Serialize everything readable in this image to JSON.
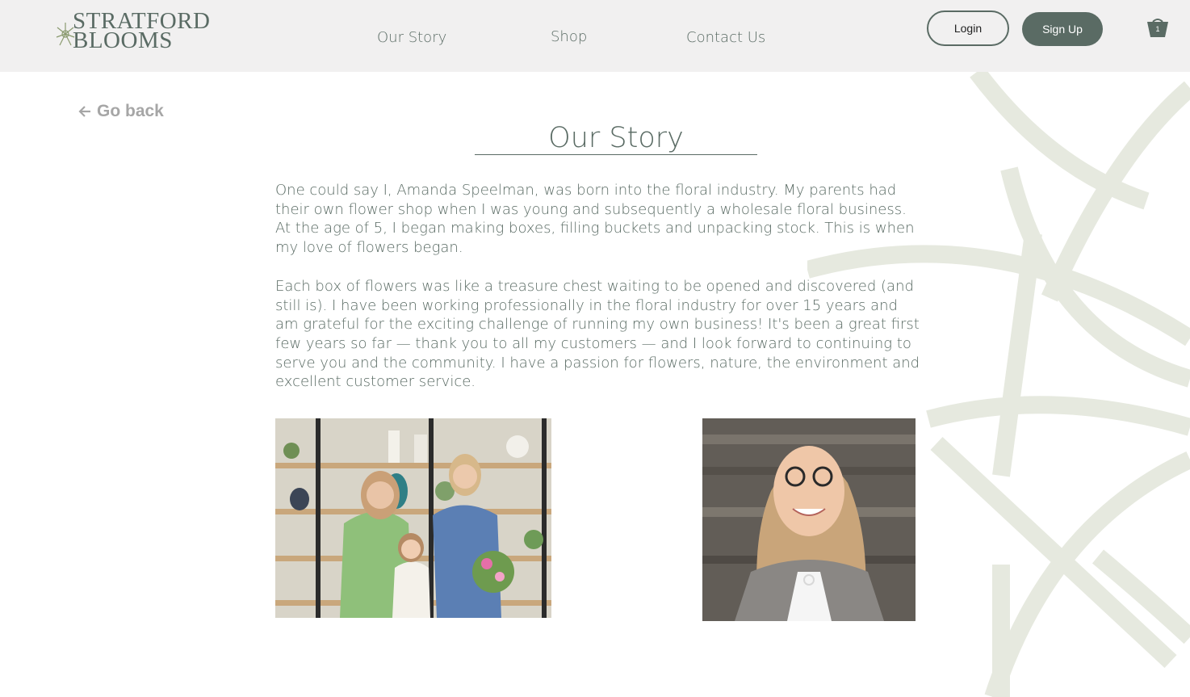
{
  "header": {
    "logo": {
      "line1": "STRATFORD",
      "line2": "BLOOMS"
    },
    "nav": [
      "Our Story",
      "Shop",
      "Contact Us"
    ],
    "login_label": "Login",
    "signup_label": "Sign Up",
    "cart_count": "1"
  },
  "back_link": "Go back",
  "title": "Our Story",
  "paragraphs": [
    "One could say I, Amanda Speelman, was born into the floral industry. My parents had their own flower shop when I was young and subsequently a wholesale floral business. At the age of 5, I began making boxes, filling buckets and unpacking stock. This is when my love of flowers began.",
    "Each box of flowers was like a treasure chest waiting to be opened and discovered (and still is). I have been working professionally in the floral industry for over 15 years and am grateful for the exciting challenge of running my own business! It's been a great first few years so far — thank you to all my customers — and I look forward to continuing to serve you and the community. I have a passion for flowers, nature, the environment and excellent customer service."
  ],
  "colors": {
    "brand": "#5a6b64",
    "header_bg": "#f1f0f0",
    "muted": "#a6a6a6",
    "decor": "#e6e9df"
  },
  "icons": [
    "flower-logo-icon",
    "back-arrow-icon",
    "cart-icon"
  ]
}
